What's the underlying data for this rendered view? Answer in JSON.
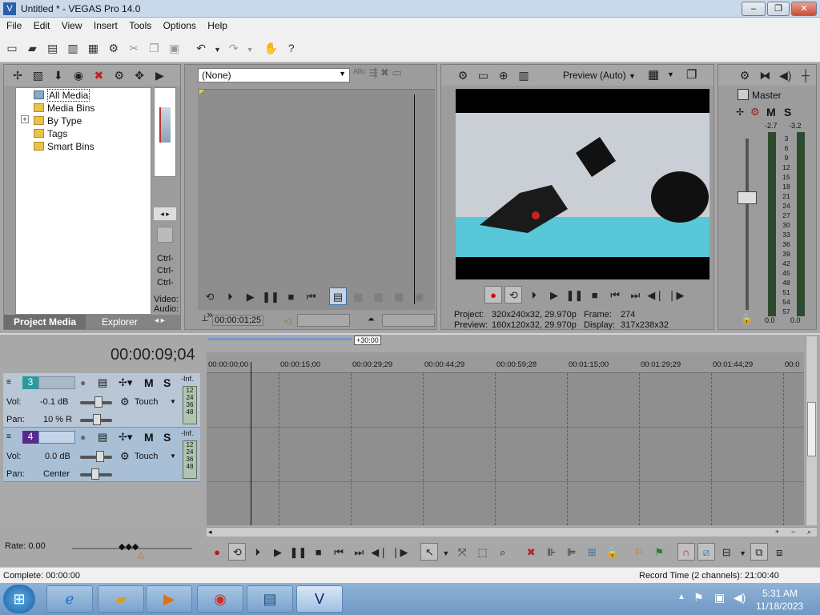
{
  "window": {
    "title": "Untitled * - VEGAS Pro 14.0",
    "min": "–",
    "max": "❐",
    "close": "✕"
  },
  "menu": [
    "File",
    "Edit",
    "View",
    "Insert",
    "Tools",
    "Options",
    "Help"
  ],
  "media": {
    "tree": [
      "All Media",
      "Media Bins",
      "By Type",
      "Tags",
      "Smart Bins"
    ],
    "expander": "+",
    "tabs": {
      "project_media": "Project Media",
      "explorer": "Explorer"
    },
    "shortcuts": [
      "Ctrl-",
      "Ctrl-",
      "Ctrl-"
    ],
    "props": [
      "Video:",
      "Audio:"
    ]
  },
  "trimmer": {
    "dropdown": "(None)",
    "timecode": "00:00:01;25"
  },
  "preview": {
    "mode": "Preview (Auto)",
    "project_label": "Project:",
    "project_value": "320x240x32, 29.970p",
    "frame_label": "Frame:",
    "frame_value": "274",
    "preview_label": "Preview:",
    "preview_value": "160x120x32, 29.970p",
    "display_label": "Display:",
    "display_value": "317x238x32"
  },
  "master": {
    "title": "Master",
    "m": "M",
    "s": "S",
    "peak_left": "-2.7",
    "peak_right": "-3.2",
    "scale": [
      "3",
      "6",
      "9",
      "12",
      "15",
      "18",
      "21",
      "24",
      "27",
      "30",
      "33",
      "36",
      "39",
      "42",
      "45",
      "48",
      "51",
      "54",
      "57"
    ],
    "bottom_left": "0.0",
    "bottom_right": "0.0"
  },
  "timeline": {
    "timecode": "00:00:09;04",
    "marker": "+30:00",
    "ticks": [
      "00:00:00;00",
      "00:00:15;00",
      "00:00:29;29",
      "00:00:44;29",
      "00:00:59;28",
      "00:01:15;00",
      "00:01:29;29",
      "00:01:44;29",
      "00:0"
    ],
    "rate": "Rate: 0.00"
  },
  "tracks": [
    {
      "number": "3",
      "vol_label": "Vol:",
      "vol": "-0.1 dB",
      "pan_label": "Pan:",
      "pan": "10 % R",
      "mode": "Touch",
      "m": "M",
      "s": "S",
      "inf": "-Inf.",
      "meter": [
        "12",
        "24",
        "36",
        "48"
      ]
    },
    {
      "number": "4",
      "vol_label": "Vol:",
      "vol": "0.0 dB",
      "pan_label": "Pan:",
      "pan": "Center",
      "mode": "Touch",
      "m": "M",
      "s": "S",
      "inf": "-Inf.",
      "meter": [
        "12",
        "24",
        "36",
        "48"
      ]
    }
  ],
  "status": {
    "complete": "Complete: 00:00:00",
    "record_time": "Record Time (2 channels): 21:00:40"
  },
  "taskbar": {
    "time": "5:31 AM",
    "date": "11/18/2023"
  },
  "colors": {
    "accent_blue": "#3a6ea5",
    "panel_gray": "#9c9c9c",
    "record_red": "#d01010"
  }
}
